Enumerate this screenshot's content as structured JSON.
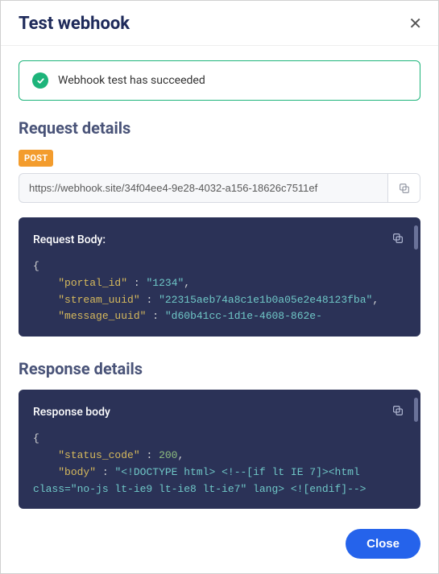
{
  "header": {
    "title": "Test webhook"
  },
  "alert": {
    "message": "Webhook test has succeeded"
  },
  "request": {
    "section_title": "Request details",
    "method": "POST",
    "url": "https://webhook.site/34f04ee4-9e28-4032-a156-18626c7511ef",
    "body_title": "Request Body:",
    "body": {
      "portal_id_key": "\"portal_id\"",
      "portal_id_val": "\"1234\"",
      "stream_uuid_key": "\"stream_uuid\"",
      "stream_uuid_val": "\"22315aeb74a8c1e1b0a05e2e48123fba\"",
      "message_uuid_key": "\"message_uuid\"",
      "message_uuid_val": "\"d60b41cc-1d1e-4608-862e-"
    }
  },
  "response": {
    "section_title": "Response details",
    "body_title": "Response body",
    "body": {
      "status_key": "\"status_code\"",
      "status_val": "200",
      "body_key": "\"body\"",
      "body_val": "\"<!DOCTYPE html> <!--[if lt IE 7]><html",
      "body_cont": "class=\"no-js lt-ie9 lt-ie8 lt-ie7\" lang> <![endif]-->"
    }
  },
  "footer": {
    "close_label": "Close"
  }
}
